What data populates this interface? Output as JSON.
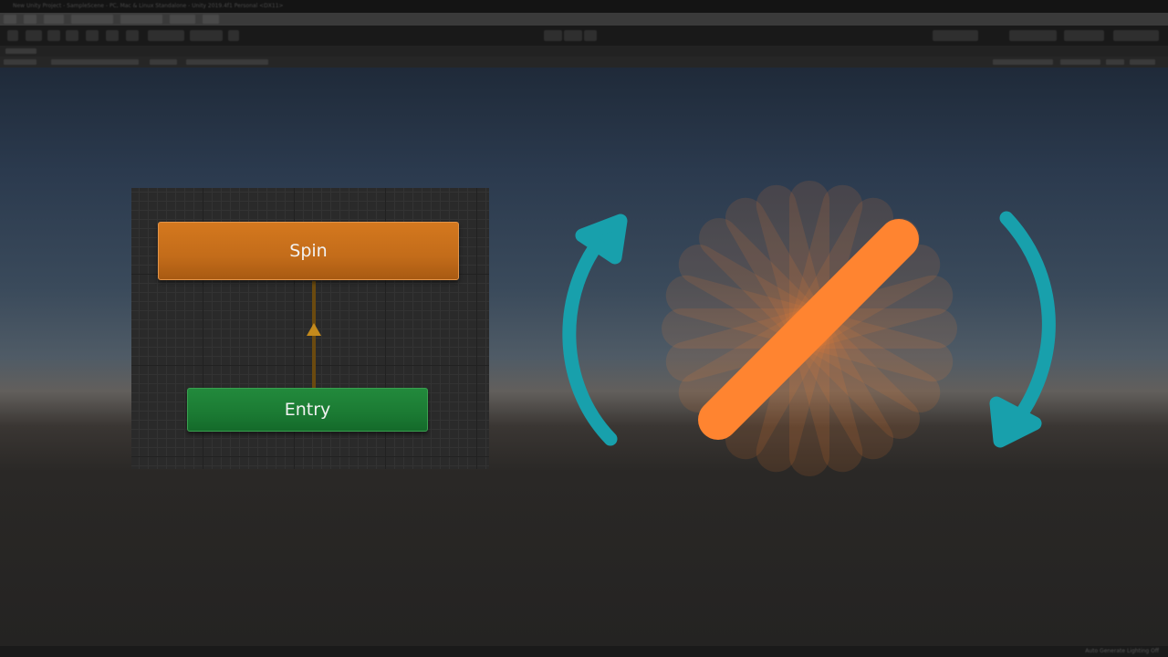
{
  "window": {
    "title": "New Unity Project - SampleScene - PC, Mac & Linux Standalone - Unity 2019.4f1 Personal <DX11>"
  },
  "animator": {
    "states": {
      "spin": "Spin",
      "entry": "Entry"
    }
  },
  "illustration": {
    "arrow_color": "#18a0ac",
    "bar_color": "#ff8430",
    "ghost_color": "#ff8430",
    "left_arrow_icon": "rotate-counterclockwise-icon",
    "right_arrow_icon": "rotate-clockwise-icon"
  },
  "status": {
    "text": "Auto Generate Lighting Off"
  }
}
